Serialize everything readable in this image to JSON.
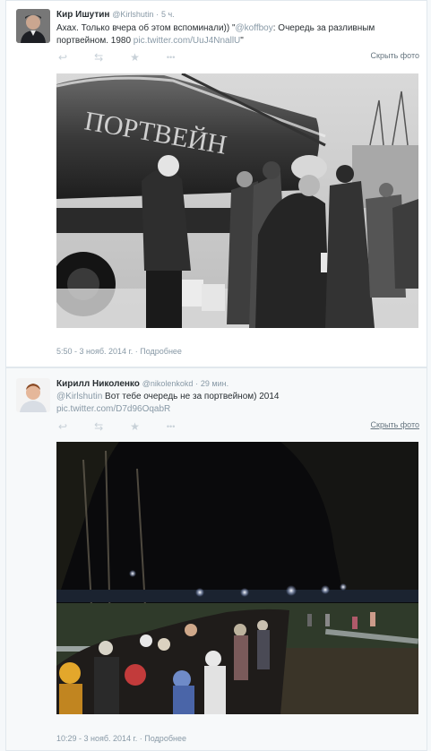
{
  "tweets": [
    {
      "fullname": "Кир Ишутин",
      "username": "@Kirlshutin",
      "separator": "·",
      "time": "5 ч.",
      "text_before": "Ахах. Только вчера об этом вспоминали)) \"",
      "mention": "@koffboy",
      "text_after": ": Очередь за разливным портвейном. 1980 ",
      "photo_link": "pic.twitter.com/UuJ4NnallU",
      "text_end": "\"",
      "hide_photo": "Скрыть фото",
      "timestamp": "5:50 - 3 нояб. 2014 г.",
      "details": "Подробнее"
    },
    {
      "fullname": "Кирилл Николенко",
      "username": "@nikolenkokd",
      "separator": "·",
      "time": "29 мин.",
      "mention": "@Kirlshutin",
      "text_after": " Вот тебе очередь не за портвейном) 2014",
      "photo_link": "pic.twitter.com/D7d96OqabR",
      "hide_photo": "Скрыть фото",
      "timestamp": "10:29 - 3 нояб. 2014 г.",
      "details": "Подробнее"
    }
  ],
  "photo1": {
    "tank_text": "ПОРТВЕЙН",
    "tone": "grayscale"
  },
  "actions": {
    "reply": "reply-icon",
    "retweet": "retweet-icon",
    "favorite": "star-icon",
    "more": "more-icon",
    "reply_glyph": "↩",
    "retweet_glyph": "⇆",
    "favorite_glyph": "★",
    "more_glyph": "•••"
  },
  "colors": {
    "link": "#8899a6",
    "border": "#e1e8ed",
    "text": "#292f33"
  }
}
